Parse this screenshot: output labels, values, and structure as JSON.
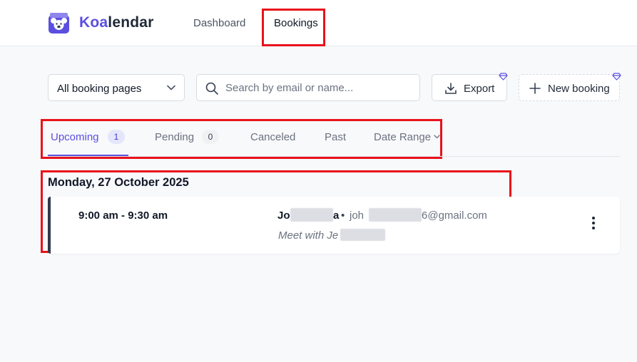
{
  "app": {
    "brand_highlight": "Koa",
    "brand_rest": "lendar",
    "brand_color": "#5b4fe0"
  },
  "nav": {
    "dashboard": "Dashboard",
    "bookings": "Bookings"
  },
  "toolbar": {
    "booking_pages_selected": "All booking pages",
    "search_placeholder": "Search by email or name...",
    "export_label": "Export",
    "new_booking_label": "New booking"
  },
  "tabs": [
    {
      "label": "Upcoming",
      "count": "1",
      "active": true
    },
    {
      "label": "Pending",
      "count": "0",
      "active": false
    },
    {
      "label": "Canceled"
    },
    {
      "label": "Past"
    },
    {
      "label": "Date Range"
    }
  ],
  "bookings": {
    "date_heading": "Monday, 27 October 2025",
    "items": [
      {
        "time": "9:00 am - 9:30 am",
        "name_start": "Jo",
        "name_end": "a",
        "separator": "•",
        "email_start": "joh",
        "email_end": "6@gmail.com",
        "title_start": "Meet with Je"
      }
    ]
  },
  "colors": {
    "accent": "#5b4fe0",
    "highlight_box": "#e8121b"
  },
  "icons": {
    "logo": "koala-logo-icon",
    "select": "chevron-down-icon",
    "search": "search-icon",
    "export": "download-icon",
    "new_booking": "plus-icon",
    "premium": "gem-icon",
    "menu": "more-vertical-icon"
  }
}
